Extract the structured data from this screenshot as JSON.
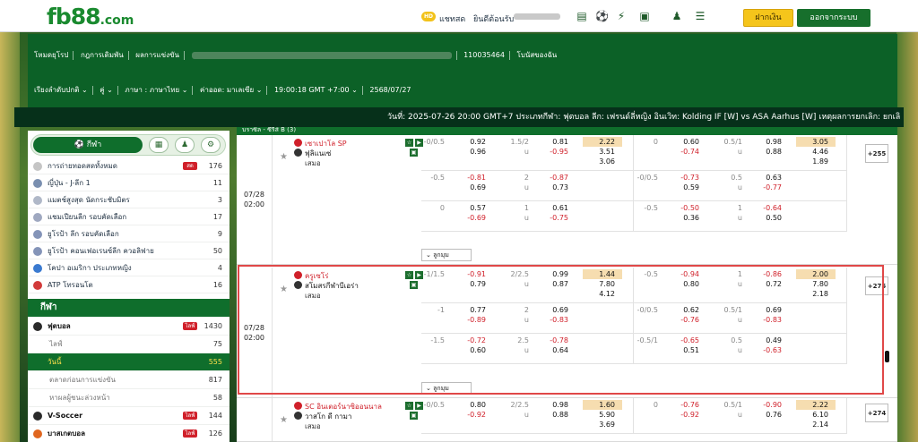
{
  "topbar": {
    "logo_main": "fb88",
    "logo_suffix": ".com",
    "hd_badge": "HD",
    "chat": "แชทสด",
    "welcome": "ยินดีต้อนรับ",
    "deposit": "ฝากเงิน",
    "logout": "ออกจากระบบ"
  },
  "header": {
    "row1": [
      "โหมดยุโรป",
      "กฎการเดิมพัน",
      "ผลการแข่งขัน",
      "110035464",
      "โบนัสของฉัน"
    ],
    "row2": [
      "เรียงลำดับปกติ",
      "คู่",
      "ภาษา : ภาษาไทย",
      "ค่าออด: มาเลเซีย",
      "19:00:18 GMT +7:00",
      "2568/07/27"
    ],
    "marquee": "วันที่: 2025-07-26 20:00 GMT+7 ประเภทกีฬา: ฟุตบอล ลีก: เฟรนด์ลี่หญิง อินเวิท: Kolding IF [W] vs ASA Aarhus [W] เหตุผลการยกเลิก: ยกเลิ"
  },
  "sidebar": {
    "tab_main": "กีฬา",
    "items": [
      {
        "name": "การถ่ายทอดสดทั้งหมด",
        "count": "176",
        "live": "สด"
      },
      {
        "name": "ญี่ปุ่น - J-ลีก 1",
        "count": "11"
      },
      {
        "name": "แมตช์สูงสุด นัดกระชับมิตร",
        "count": "3"
      },
      {
        "name": "แชมเปียนลีก รอบคัดเลือก",
        "count": "17"
      },
      {
        "name": "ยูโรป้า ลีก รอบคัดเลือก",
        "count": "9"
      },
      {
        "name": "ยูโรป้า คอนเฟอเรนซ์ลีก ควอลิฟาย",
        "count": "50"
      },
      {
        "name": "โคปา อเมริกา ประเภทหญิง",
        "count": "4"
      },
      {
        "name": "ATP โทรอนโต",
        "count": "16"
      }
    ],
    "section": "กีฬา",
    "sports": [
      {
        "name": "ฟุตบอล",
        "count": "1430",
        "live": "ไลฟ์",
        "kind": "bold"
      },
      {
        "name": "ไลฟ์",
        "count": "75",
        "kind": "sub"
      },
      {
        "name": "วันนี้",
        "count": "555",
        "kind": "active"
      },
      {
        "name": "ตลาดก่อนการแข่งขัน",
        "count": "817",
        "kind": "sub"
      },
      {
        "name": "หาผลผู้ชนะล่วงหน้า",
        "count": "58",
        "kind": "sub"
      },
      {
        "name": "V-Soccer",
        "count": "144",
        "live": "ไลฟ์",
        "kind": "bold"
      },
      {
        "name": "บาสเกตบอล",
        "count": "126",
        "live": "ไลฟ์",
        "kind": "bold"
      }
    ]
  },
  "main": {
    "league_header": "บราซิล - ซีรีส์ B (3)",
    "expand_label": "ลูกมุม",
    "matches": [
      {
        "date": "07/28\n02:00",
        "home": "เซาเปาโล SP",
        "away": "ฟุลิแนเซ่",
        "draw": "เสมอ",
        "more": "+255",
        "rows": [
          [
            "-0/0.5",
            "0.92",
            "0.96",
            "1.5/2",
            "u",
            "0.81",
            "-0.95",
            "2.22",
            "3.51",
            "3.06",
            "0",
            "0.60",
            "-0.74",
            "0.5/1",
            "u",
            "0.98",
            "0.88",
            "3.05",
            "4.46",
            "1.89"
          ],
          [
            "-0.5",
            "-0.81",
            "0.69",
            "2",
            "u",
            "-0.87",
            "0.73",
            "",
            "",
            "",
            "-0/0.5",
            "-0.73",
            "0.59",
            "0.5",
            "u",
            "0.63",
            "-0.77",
            "",
            "",
            ""
          ],
          [
            "0",
            "0.57",
            "-0.69",
            "1",
            "u",
            "0.61",
            "-0.75",
            "",
            "",
            "",
            "-0.5",
            "-0.50",
            "0.36",
            "1",
            "u",
            "-0.64",
            "0.50",
            "",
            "",
            ""
          ]
        ]
      },
      {
        "date": "07/28\n02:00",
        "home": "ครูเซโร่",
        "away": "สโมสรกีฬาบีเอร่า",
        "draw": "เสมอ",
        "more": "+275",
        "rows": [
          [
            "-1/1.5",
            "-0.91",
            "0.79",
            "2/2.5",
            "u",
            "0.99",
            "0.87",
            "1.44",
            "7.80",
            "4.12",
            "-0.5",
            "-0.94",
            "0.80",
            "1",
            "u",
            "-0.86",
            "0.72",
            "2.00",
            "7.80",
            "2.18"
          ],
          [
            "-1",
            "0.77",
            "-0.89",
            "2",
            "u",
            "0.69",
            "-0.83",
            "",
            "",
            "",
            "-0/0.5",
            "0.62",
            "-0.76",
            "0.5/1",
            "u",
            "0.69",
            "-0.83",
            "",
            "",
            ""
          ],
          [
            "-1.5",
            "-0.72",
            "0.60",
            "2.5",
            "u",
            "-0.78",
            "0.64",
            "",
            "",
            "",
            "-0.5/1",
            "-0.65",
            "0.51",
            "0.5",
            "u",
            "0.49",
            "-0.63",
            "",
            "",
            ""
          ]
        ]
      },
      {
        "date": "",
        "home": "SC อินเตอร์นาซิออนนาล",
        "away": "วาสโก ดี กามา",
        "draw": "เสมอ",
        "more": "+274",
        "rows": [
          [
            "-0/0.5",
            "0.80",
            "-0.92",
            "2/2.5",
            "u",
            "0.98",
            "0.88",
            "1.60",
            "5.90",
            "3.69",
            "0",
            "-0.76",
            "-0.92",
            "0.5/1",
            "u",
            "-0.90",
            "0.76",
            "2.22",
            "6.10",
            "2.14"
          ]
        ]
      }
    ]
  },
  "colors": {
    "brand_green": "#0f6e2c",
    "accent_yellow": "#f5c51b",
    "red_odds": "#d0202a",
    "highlight": "#f6ddb0"
  }
}
